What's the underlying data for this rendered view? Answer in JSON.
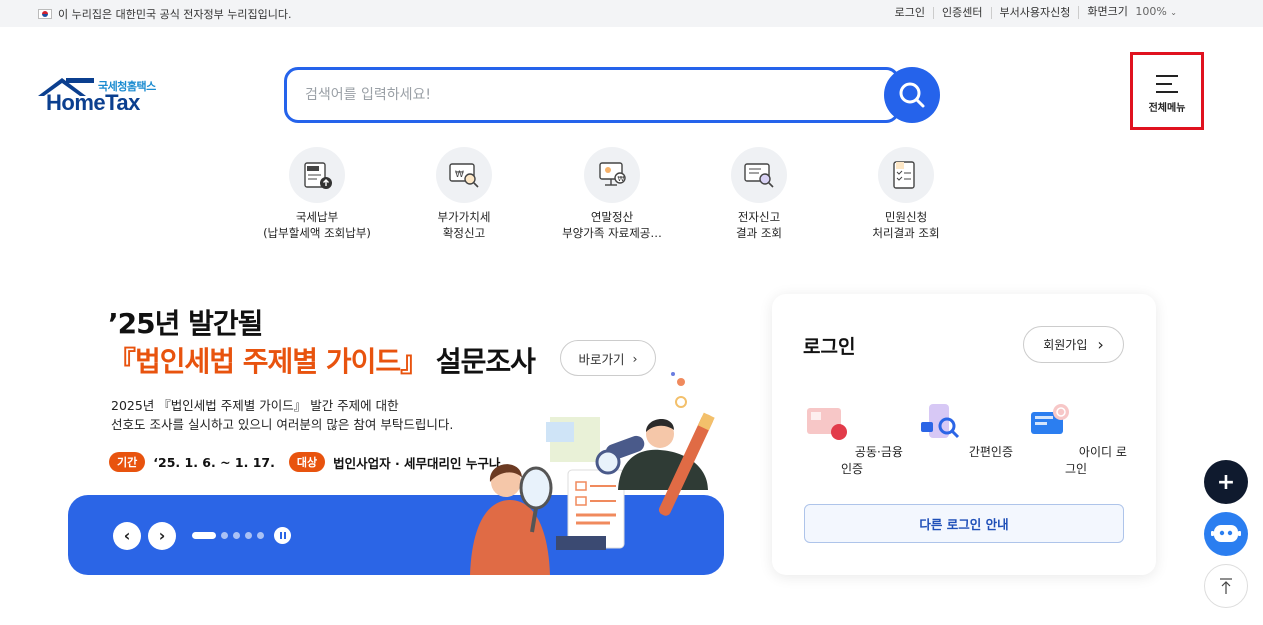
{
  "topbar": {
    "gov_notice": "이 누리집은 대한민국 공식 전자정부 누리집입니다.",
    "links": [
      "로그인",
      "인증센터",
      "부서사용자신청"
    ],
    "zoom_label": "화면크기",
    "zoom_value": "100%"
  },
  "logo": {
    "sub": "국세청홈택스",
    "main": "HomeTax"
  },
  "search": {
    "placeholder": "검색어를 입력하세요!"
  },
  "all_menu": {
    "label": "전체메뉴"
  },
  "quick_menu": [
    {
      "line1": "국세납부",
      "line2": "(납부할세액 조회납부)",
      "icon": "tax-payment-icon"
    },
    {
      "line1": "부가가치세",
      "line2": "확정신고",
      "icon": "vat-report-icon"
    },
    {
      "line1": "연말정산",
      "line2": "부양가족 자료제공…",
      "icon": "year-end-settlement-icon"
    },
    {
      "line1": "전자신고",
      "line2": "결과 조회",
      "icon": "e-filing-result-icon"
    },
    {
      "line1": "민원신청",
      "line2": "처리결과 조회",
      "icon": "civil-request-icon"
    }
  ],
  "banner": {
    "title_line1": "’25년 발간될",
    "title_highlight": "『법인세법 주제별 가이드』",
    "title_rest": " 설문조사",
    "go_button": "바로가기",
    "desc_line1": "2025년 『법인세법 주제별 가이드』 발간 주제에 대한",
    "desc_line2": "선호도 조사를 실시하고 있으니 여러분의 많은 참여 부탁드립니다.",
    "period_badge": "기간",
    "period_value": "‘25. 1. 6. ~ 1. 17.",
    "target_badge": "대상",
    "target_value": "법인사업자 · 세무대리인 누구나"
  },
  "login": {
    "title": "로그인",
    "signup_button": "회원가입",
    "options": [
      "공동·금융인증",
      "간편인증",
      "아이디 로그인"
    ],
    "other_button": "다른 로그인 안내"
  },
  "colors": {
    "primary": "#2563eb",
    "accent": "#e8530e",
    "highlight_box": "#e0121f"
  }
}
